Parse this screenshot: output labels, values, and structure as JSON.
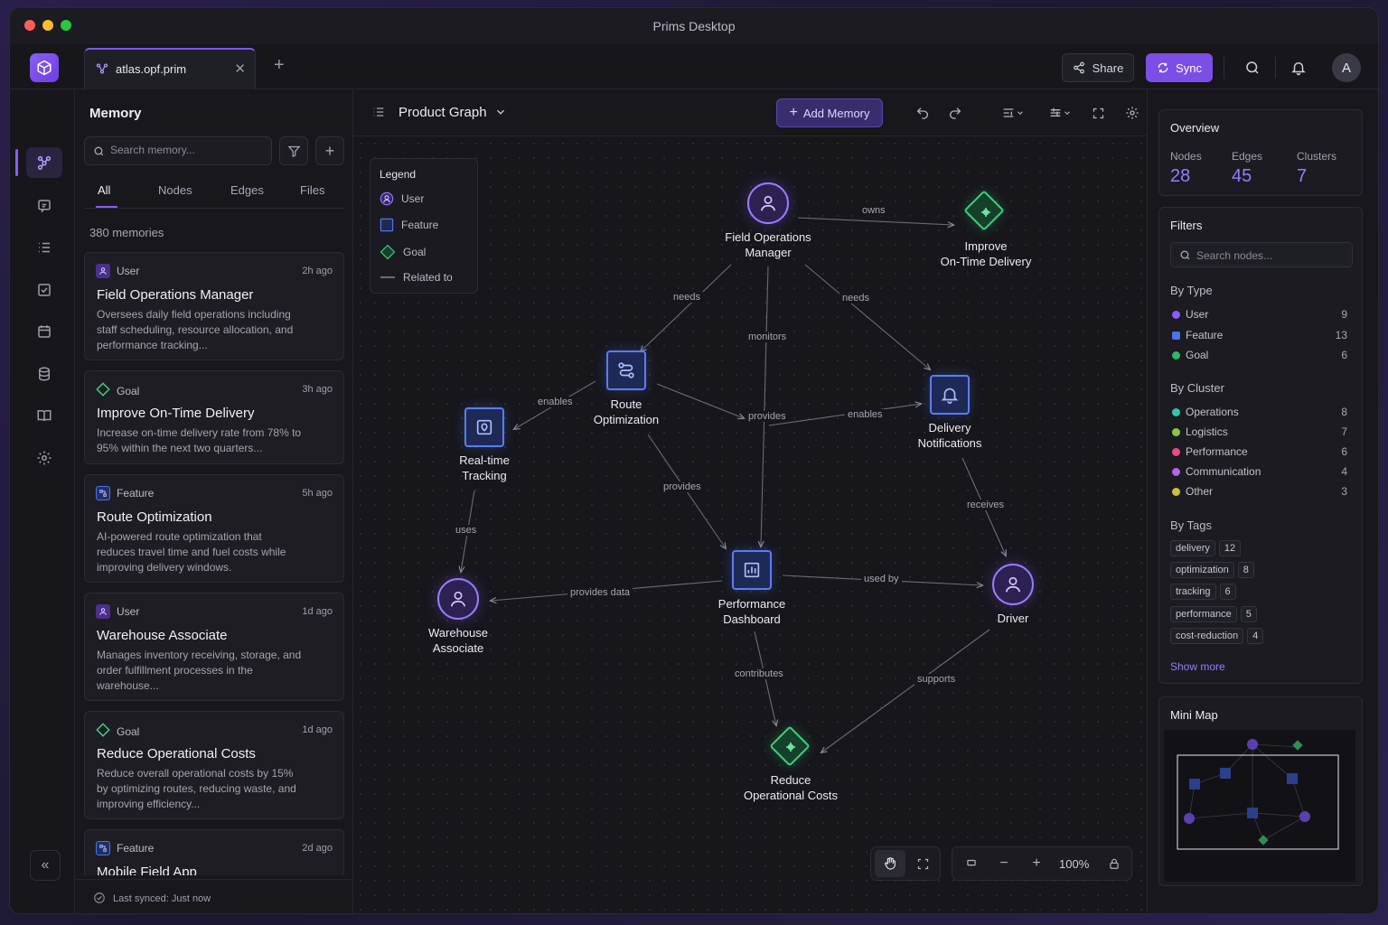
{
  "window": {
    "title": "Prims Desktop"
  },
  "tabbar": {
    "tab_label": "atlas.opf.prim",
    "share_label": "Share",
    "sync_label": "Sync",
    "avatar_initial": "A"
  },
  "memory": {
    "title": "Memory",
    "search_placeholder": "Search memory...",
    "tabs": [
      "All",
      "Nodes",
      "Edges",
      "Files"
    ],
    "count": "380 memories",
    "footer": "Last synced: Just now",
    "cards": [
      {
        "type": "User",
        "time": "2h ago",
        "title": "Field Operations Manager",
        "desc": "Oversees daily field operations including staff scheduling, resource allocation, and performance tracking..."
      },
      {
        "type": "Goal",
        "time": "3h ago",
        "title": "Improve On-Time Delivery",
        "desc": "Increase on-time delivery rate from 78% to 95% within the next two quarters..."
      },
      {
        "type": "Feature",
        "time": "5h ago",
        "title": "Route Optimization",
        "desc": "AI-powered route optimization that reduces travel time and fuel costs while improving delivery windows."
      },
      {
        "type": "User",
        "time": "1d ago",
        "title": "Warehouse Associate",
        "desc": "Manages inventory receiving, storage, and order fulfillment processes in the warehouse..."
      },
      {
        "type": "Goal",
        "time": "1d ago",
        "title": "Reduce Operational Costs",
        "desc": "Reduce overall operational costs by 15% by optimizing routes, reducing waste, and improving efficiency..."
      },
      {
        "type": "Feature",
        "time": "2d ago",
        "title": "Mobile Field App",
        "desc": ""
      }
    ]
  },
  "canvas": {
    "graph_title": "Product Graph",
    "add_memory_label": "Add Memory",
    "zoom": "100%",
    "legend": {
      "title": "Legend",
      "user": "User",
      "feature": "Feature",
      "goal": "Goal",
      "related": "Related to"
    },
    "nodes": {
      "fom": "Field Operations\nManager",
      "iotd": "Improve\nOn-Time Delivery",
      "ro": "Route\nOptimization",
      "dn": "Delivery\nNotifications",
      "rtt": "Real-time\nTracking",
      "pd": "Performance\nDashboard",
      "wa": "Warehouse\nAssociate",
      "driver": "Driver",
      "roc": "Reduce\nOperational Costs"
    },
    "edges": {
      "owns": "owns",
      "needs1": "needs",
      "needs2": "needs",
      "monitors": "monitors",
      "enables1": "enables",
      "enables2": "enables",
      "provides1": "provides",
      "provides2": "provides",
      "receives": "receives",
      "uses": "uses",
      "provides_data": "provides data",
      "used_by": "used by",
      "contributes": "contributes",
      "supports": "supports"
    }
  },
  "overview": {
    "title": "Overview",
    "nodes_label": "Nodes",
    "nodes_value": "28",
    "edges_label": "Edges",
    "edges_value": "45",
    "clusters_label": "Clusters",
    "clusters_value": "7"
  },
  "filters": {
    "title": "Filters",
    "search_placeholder": "Search nodes...",
    "by_type_label": "By Type",
    "types": [
      {
        "label": "User",
        "count": "9",
        "color": "#8b5cf6"
      },
      {
        "label": "Feature",
        "count": "13",
        "color": "#4f6ef0"
      },
      {
        "label": "Goal",
        "count": "6",
        "color": "#2fb86a"
      }
    ],
    "by_cluster_label": "By Cluster",
    "clusters": [
      {
        "label": "Operations",
        "count": "8",
        "color": "#2fc7a8"
      },
      {
        "label": "Logistics",
        "count": "7",
        "color": "#8bc34a"
      },
      {
        "label": "Performance",
        "count": "6",
        "color": "#e84a8a"
      },
      {
        "label": "Communication",
        "count": "4",
        "color": "#b068e0"
      },
      {
        "label": "Other",
        "count": "3",
        "color": "#c9c23a"
      }
    ],
    "by_tags_label": "By Tags",
    "tags": [
      {
        "label": "delivery",
        "count": "12"
      },
      {
        "label": "optimization",
        "count": "8"
      },
      {
        "label": "tracking",
        "count": "6"
      },
      {
        "label": "performance",
        "count": "5"
      },
      {
        "label": "cost-reduction",
        "count": "4"
      }
    ],
    "show_more": "Show more"
  },
  "minimap": {
    "title": "Mini Map"
  }
}
